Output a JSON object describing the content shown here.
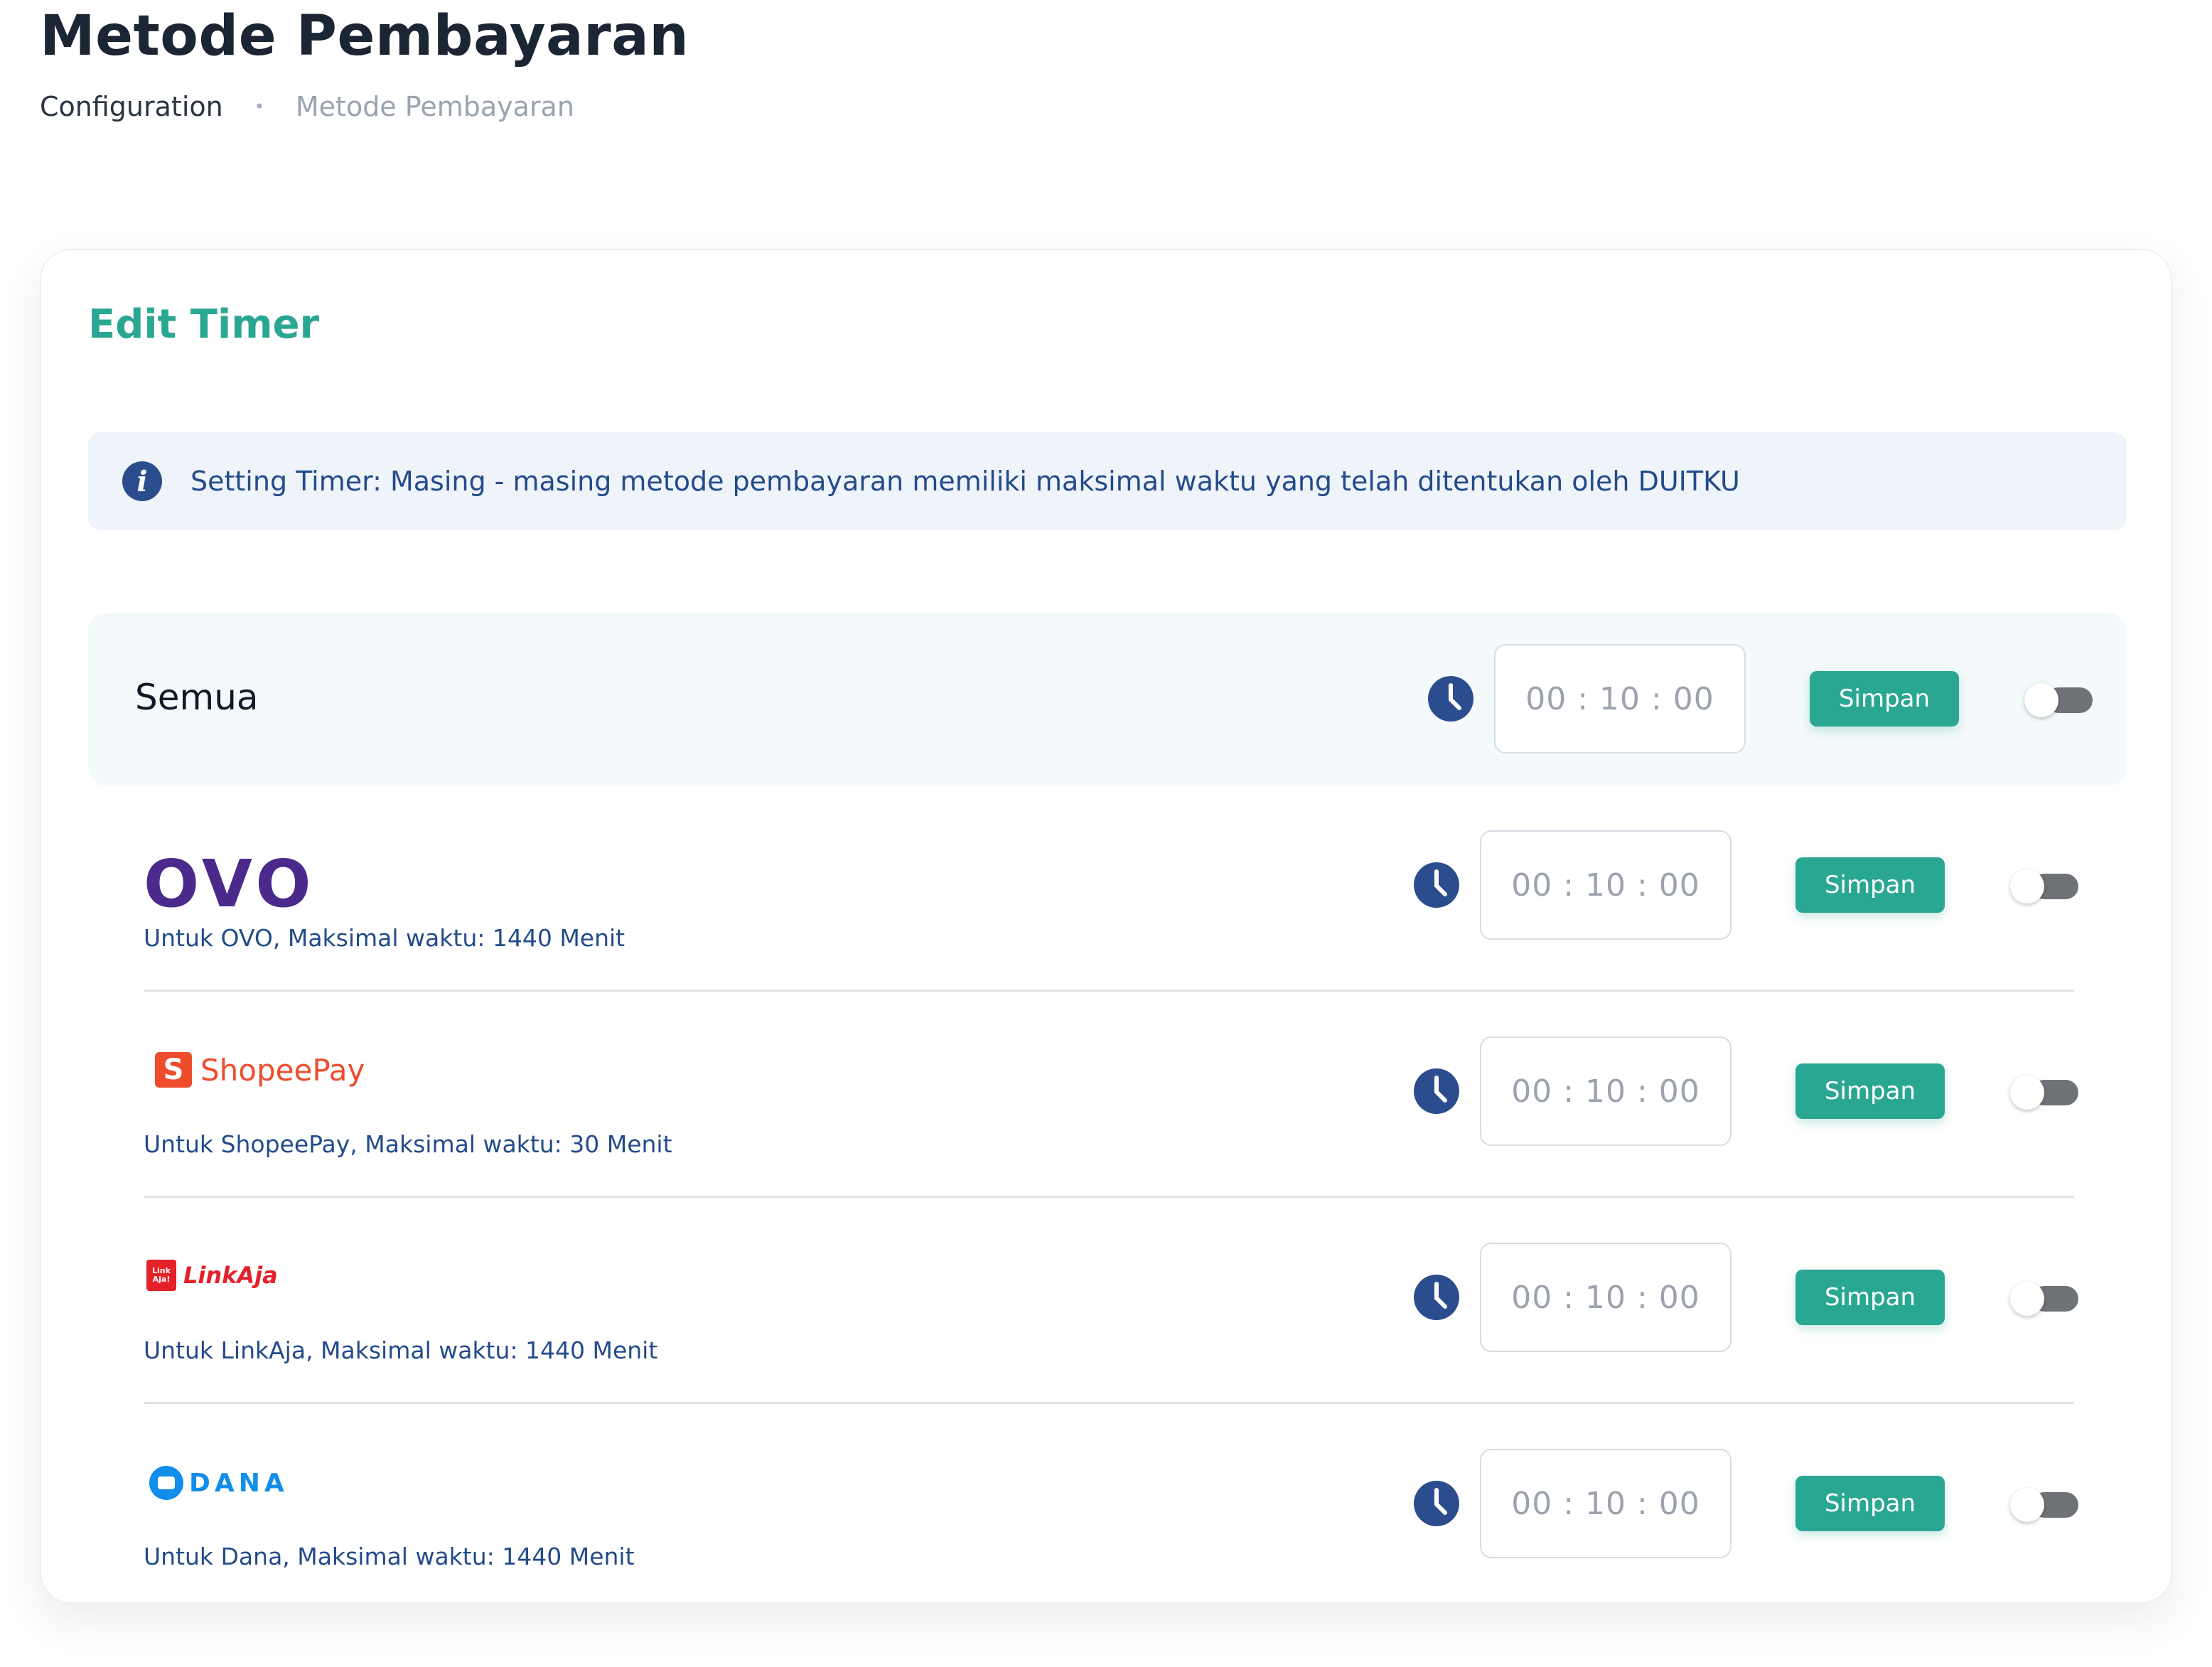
{
  "header": {
    "title": "Metode Pembayaran",
    "breadcrumb": [
      "Configuration",
      "Metode Pembayaran"
    ],
    "breadcrumb_separator": "•"
  },
  "card": {
    "title": "Edit Timer",
    "alert": {
      "icon": "info-icon",
      "icon_glyph": "i",
      "text": "Setting Timer: Masing - masing metode pembayaran memiliki maksimal waktu yang telah ditentukan oleh DUITKU"
    },
    "all_row": {
      "label": "Semua",
      "time": "00 : 10 : 00",
      "save_label": "Simpan",
      "toggle_on": false
    },
    "methods": [
      {
        "logo": "OVO",
        "description": "Untuk OVO, Maksimal waktu: 1440 Menit",
        "time": "00 : 10 : 00",
        "save_label": "Simpan",
        "toggle_on": false
      },
      {
        "logo": "ShopeePay",
        "logo_glyph": "S",
        "description": "Untuk ShopeePay, Maksimal waktu: 30 Menit",
        "time": "00 : 10 : 00",
        "save_label": "Simpan",
        "toggle_on": false
      },
      {
        "logo": "LinkAja",
        "logo_glyph": "Link Aja!",
        "description": "Untuk LinkAja, Maksimal waktu: 1440 Menit",
        "time": "00 : 10 : 00",
        "save_label": "Simpan",
        "toggle_on": false
      },
      {
        "logo": "DANA",
        "description": "Untuk Dana, Maksimal waktu: 1440 Menit",
        "time": "00 : 10 : 00",
        "save_label": "Simpan",
        "toggle_on": false
      }
    ]
  },
  "colors": {
    "accent": "#2aa792",
    "primary_text": "#234b8a",
    "clock_icon": "#2c4d8d",
    "alert_bg": "#eff3fa",
    "ovo": "#4b2a8c",
    "shopeepay": "#ee4d2d",
    "linkaja": "#e4212a",
    "dana": "#118eea"
  }
}
